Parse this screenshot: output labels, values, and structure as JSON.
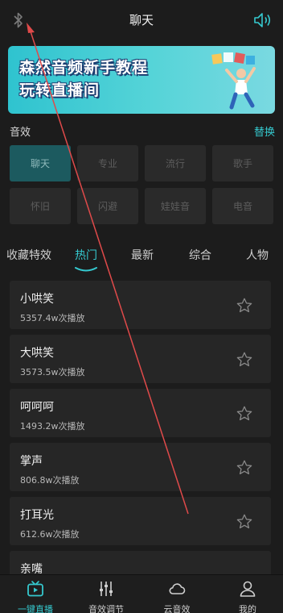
{
  "header": {
    "title": "聊天",
    "bluetooth_icon": "bluetooth-icon",
    "volume_icon": "volume-icon"
  },
  "banner": {
    "line1": "森然音频新手教程",
    "line2": "玩转直播间"
  },
  "effects_section": {
    "label": "音效",
    "switch_label": "替换"
  },
  "effects": [
    {
      "label": "聊天",
      "active": true
    },
    {
      "label": "专业",
      "active": false
    },
    {
      "label": "流行",
      "active": false
    },
    {
      "label": "歌手",
      "active": false
    },
    {
      "label": "怀旧",
      "active": false
    },
    {
      "label": "闪避",
      "active": false
    },
    {
      "label": "娃娃音",
      "active": false
    },
    {
      "label": "电音",
      "active": false
    }
  ],
  "tabs": [
    {
      "label": "收藏特效",
      "active": false
    },
    {
      "label": "热门",
      "active": true
    },
    {
      "label": "最新",
      "active": false
    },
    {
      "label": "综合",
      "active": false
    },
    {
      "label": "人物",
      "active": false
    }
  ],
  "sounds": [
    {
      "name": "小哄笑",
      "plays": "5357.4w次播放"
    },
    {
      "name": "大哄笑",
      "plays": "3573.5w次播放"
    },
    {
      "name": "呵呵呵",
      "plays": "1493.2w次播放"
    },
    {
      "name": "掌声",
      "plays": "806.8w次播放"
    },
    {
      "name": "打耳光",
      "plays": "612.6w次播放"
    },
    {
      "name": "亲嘴",
      "plays": ""
    }
  ],
  "bottom_nav": [
    {
      "label": "一键直播",
      "icon": "live-tv-icon",
      "active": true
    },
    {
      "label": "音效调节",
      "icon": "equalizer-icon",
      "active": false
    },
    {
      "label": "云音效",
      "icon": "cloud-icon",
      "active": false
    },
    {
      "label": "我的",
      "icon": "user-icon",
      "active": false
    }
  ],
  "colors": {
    "accent": "#35c9cf",
    "background": "#1c1c1c",
    "card": "#262626",
    "annotation_arrow": "#e04a4a"
  }
}
